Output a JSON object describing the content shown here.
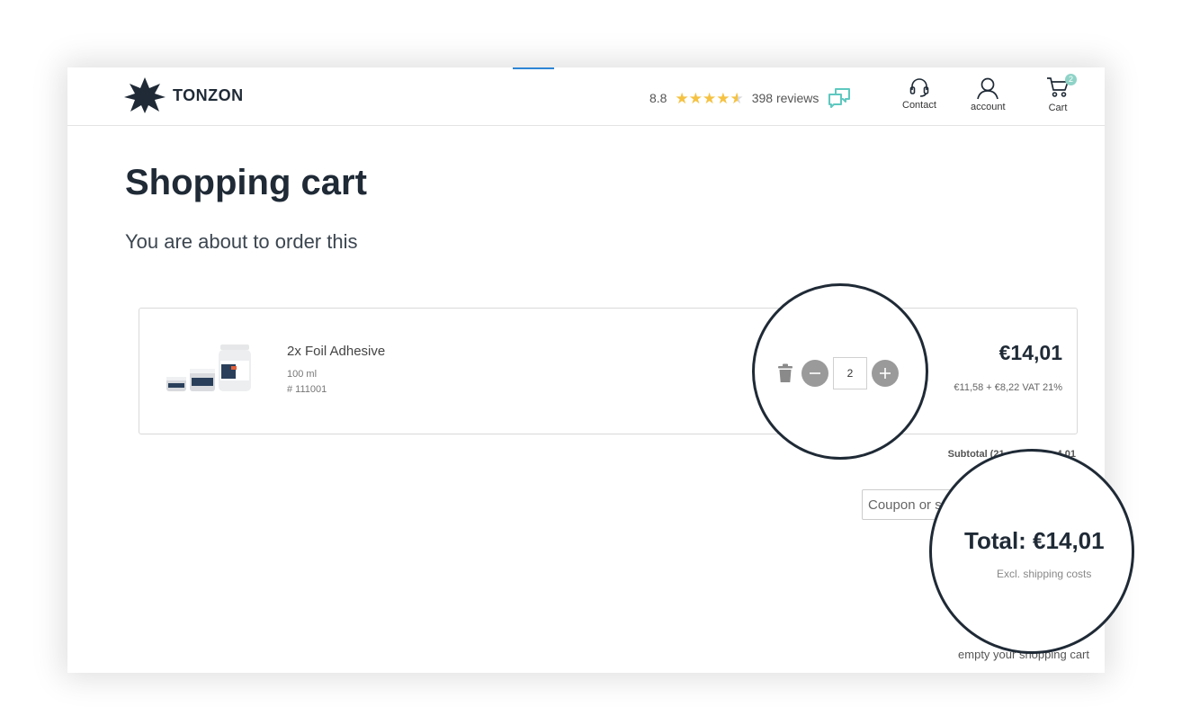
{
  "brand": {
    "name": "TONZON"
  },
  "header": {
    "rating_score": "8.8",
    "rating_stars": 4.5,
    "reviews": "398 reviews",
    "contact_label": "Contact",
    "account_label": "account",
    "cart_label": "Cart",
    "cart_count": "2"
  },
  "page": {
    "title": "Shopping cart",
    "subtitle": "You are about to order this"
  },
  "cart_item": {
    "name": "2x Foil Adhesive",
    "size": "100 ml",
    "sku": "# 111001",
    "quantity": "2",
    "price": "€14,01",
    "vat_breakdown": "€11,58 + €8,22 VAT 21%"
  },
  "summary": {
    "subtotal_visible": "Subtotal (21",
    "subtotal_tail": "4,01",
    "coupon_placeholder": "Coupon or s",
    "total": "Total: €14,01",
    "shipping_note": "Excl. shipping costs",
    "empty_cart_link": "empty your shopping cart"
  },
  "colors": {
    "brand_dark": "#1f2a36",
    "star": "#f5c242",
    "reviews_icon": "#5ec8c0",
    "badge": "#8fd3c7",
    "button_grey": "#9a9a9a",
    "accent_blue": "#2f86d6"
  }
}
